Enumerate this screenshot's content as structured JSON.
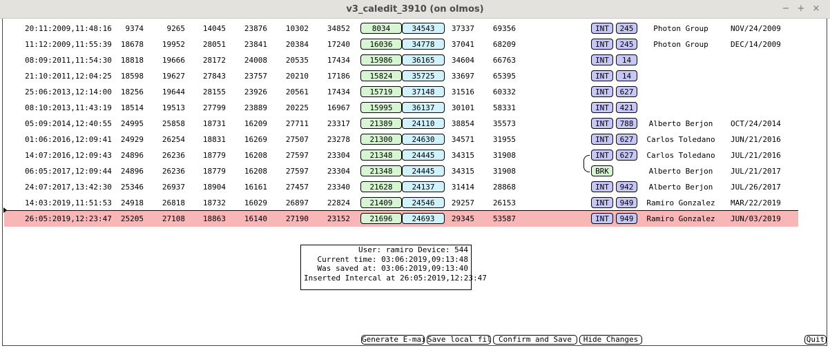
{
  "window": {
    "title": "v3_caledit_3910 (on olmos)",
    "controls": {
      "minimize": "−",
      "maximize": "+",
      "close": "×"
    }
  },
  "rows": [
    {
      "time": "20:11:2009,11:48:16",
      "v1": "9374",
      "v2": "9265",
      "v3": "14045",
      "v4": "23876",
      "v5": "10302",
      "v6": "34852",
      "g": "8034",
      "c": "34543",
      "v7": "37337",
      "v8": "69356",
      "type": "INT",
      "code": "245",
      "name": "Photon Group",
      "date": "NOV/24/2009"
    },
    {
      "time": "11:12:2009,11:55:39",
      "v1": "18678",
      "v2": "19952",
      "v3": "28051",
      "v4": "23841",
      "v5": "20384",
      "v6": "17240",
      "g": "16036",
      "c": "34778",
      "v7": "37041",
      "v8": "68209",
      "type": "INT",
      "code": "245",
      "name": "Photon Group",
      "date": "DEC/14/2009"
    },
    {
      "time": "08:09:2011,11:54:30",
      "v1": "18818",
      "v2": "19666",
      "v3": "28172",
      "v4": "24008",
      "v5": "20535",
      "v6": "17434",
      "g": "15986",
      "c": "36165",
      "v7": "34604",
      "v8": "66763",
      "type": "INT",
      "code": "14",
      "name": "",
      "date": ""
    },
    {
      "time": "21:10:2011,12:04:25",
      "v1": "18598",
      "v2": "19627",
      "v3": "27843",
      "v4": "23757",
      "v5": "20210",
      "v6": "17186",
      "g": "15824",
      "c": "35725",
      "v7": "33697",
      "v8": "65395",
      "type": "INT",
      "code": "14",
      "name": "",
      "date": ""
    },
    {
      "time": "25:06:2013,12:14:00",
      "v1": "18256",
      "v2": "19644",
      "v3": "28155",
      "v4": "23926",
      "v5": "20561",
      "v6": "17434",
      "g": "15719",
      "c": "37148",
      "v7": "31516",
      "v8": "60332",
      "type": "INT",
      "code": "627",
      "name": "",
      "date": ""
    },
    {
      "time": "08:10:2013,11:43:19",
      "v1": "18514",
      "v2": "19513",
      "v3": "27799",
      "v4": "23889",
      "v5": "20225",
      "v6": "16967",
      "g": "15995",
      "c": "36137",
      "v7": "30101",
      "v8": "58331",
      "type": "INT",
      "code": "421",
      "name": "",
      "date": ""
    },
    {
      "time": "05:09:2014,12:40:55",
      "v1": "24995",
      "v2": "25858",
      "v3": "18731",
      "v4": "16209",
      "v5": "27711",
      "v6": "23317",
      "g": "21389",
      "c": "24110",
      "v7": "38854",
      "v8": "35573",
      "type": "INT",
      "code": "788",
      "name": "Alberto Berjon",
      "date": "OCT/24/2014"
    },
    {
      "time": "01:06:2016,12:09:41",
      "v1": "24929",
      "v2": "26254",
      "v3": "18831",
      "v4": "16269",
      "v5": "27507",
      "v6": "23278",
      "g": "21300",
      "c": "24630",
      "v7": "34571",
      "v8": "31955",
      "type": "INT",
      "code": "627",
      "name": "Carlos Toledano",
      "date": "JUN/21/2016"
    },
    {
      "time": "14:07:2016,12:09:43",
      "v1": "24896",
      "v2": "26236",
      "v3": "18779",
      "v4": "16208",
      "v5": "27597",
      "v6": "23304",
      "g": "21348",
      "c": "24445",
      "v7": "34315",
      "v8": "31908",
      "type": "INT",
      "code": "627",
      "name": "Carlos Toledano",
      "date": "JUL/21/2016"
    },
    {
      "time": "06:05:2017,12:09:44",
      "v1": "24896",
      "v2": "26236",
      "v3": "18779",
      "v4": "16208",
      "v5": "27597",
      "v6": "23304",
      "g": "21348",
      "c": "24445",
      "v7": "34315",
      "v8": "31908",
      "type": "BRK",
      "code": "",
      "name": "Alberto Berjon",
      "date": "JUL/21/2017"
    },
    {
      "time": "24:07:2017,13:42:30",
      "v1": "25346",
      "v2": "26937",
      "v3": "18904",
      "v4": "16161",
      "v5": "27457",
      "v6": "23340",
      "g": "21628",
      "c": "24137",
      "v7": "31414",
      "v8": "28868",
      "type": "INT",
      "code": "942",
      "name": "Alberto Berjon",
      "date": "JUL/26/2017"
    },
    {
      "time": "14:03:2019,11:51:53",
      "v1": "24918",
      "v2": "26818",
      "v3": "18732",
      "v4": "16029",
      "v5": "26897",
      "v6": "22824",
      "g": "21409",
      "c": "24546",
      "v7": "29257",
      "v8": "26153",
      "type": "INT",
      "code": "949",
      "name": "Ramiro Gonzalez",
      "date": "MAR/22/2019"
    },
    {
      "time": "26:05:2019,12:23:47",
      "v1": "25205",
      "v2": "27108",
      "v3": "18863",
      "v4": "16140",
      "v5": "27190",
      "v6": "23152",
      "g": "21696",
      "c": "24693",
      "v7": "29345",
      "v8": "53587",
      "type": "INT",
      "code": "949",
      "name": "Ramiro Gonzalez",
      "date": "JUN/03/2019"
    }
  ],
  "selected_row": 12,
  "info": {
    "line1": "User: ramiro Device: 544",
    "line2": "Current time: 03:06:2019,09:13:48",
    "line3": "Was saved at: 03:06:2019,09:13:40",
    "line4": "Inserted Intercal at 26:05:2019,12:23:47"
  },
  "buttons": {
    "generate_email": "Generate E-mail",
    "save_local": "Save local file",
    "confirm_save": "Confirm and Save",
    "hide_changes": "Hide Changes",
    "quit": "Quit"
  },
  "colors": {
    "highlight": "#f8b6b6",
    "green_cell": "#d8f5d3",
    "cyan_cell": "#d2f2fb",
    "tag": "#c6c6f7"
  }
}
